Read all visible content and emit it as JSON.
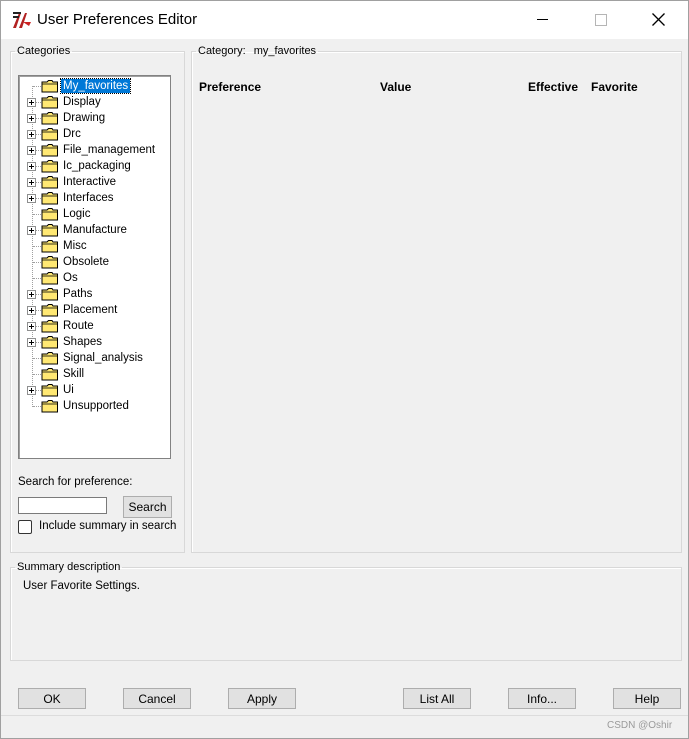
{
  "window": {
    "title": "User Preferences Editor",
    "controls": {
      "minimize": "minimize",
      "maximize": "maximize",
      "close": "close"
    }
  },
  "categories": {
    "legend": "Categories",
    "tree": [
      {
        "label": "My_favorites",
        "expandable": false,
        "selected": true
      },
      {
        "label": "Display",
        "expandable": true
      },
      {
        "label": "Drawing",
        "expandable": true
      },
      {
        "label": "Drc",
        "expandable": true
      },
      {
        "label": "File_management",
        "expandable": true
      },
      {
        "label": "Ic_packaging",
        "expandable": true
      },
      {
        "label": "Interactive",
        "expandable": true
      },
      {
        "label": "Interfaces",
        "expandable": true
      },
      {
        "label": "Logic",
        "expandable": false
      },
      {
        "label": "Manufacture",
        "expandable": true
      },
      {
        "label": "Misc",
        "expandable": false
      },
      {
        "label": "Obsolete",
        "expandable": false
      },
      {
        "label": "Os",
        "expandable": false
      },
      {
        "label": "Paths",
        "expandable": true
      },
      {
        "label": "Placement",
        "expandable": true
      },
      {
        "label": "Route",
        "expandable": true
      },
      {
        "label": "Shapes",
        "expandable": true
      },
      {
        "label": "Signal_analysis",
        "expandable": false
      },
      {
        "label": "Skill",
        "expandable": false
      },
      {
        "label": "Ui",
        "expandable": true
      },
      {
        "label": "Unsupported",
        "expandable": false
      }
    ],
    "search_label": "Search for preference:",
    "search_value": "",
    "search_button": "Search",
    "include_summary_label": "Include summary in search",
    "include_summary_checked": false
  },
  "category_panel": {
    "label": "Category:",
    "value": "my_favorites",
    "columns": [
      "Preference",
      "Value",
      "Effective",
      "Favorite"
    ]
  },
  "summary": {
    "legend": "Summary description",
    "text": "User Favorite Settings."
  },
  "buttons": {
    "ok": "OK",
    "cancel": "Cancel",
    "apply": "Apply",
    "list_all": "List All",
    "info": "Info...",
    "help": "Help"
  },
  "watermark": "CSDN @Oshir",
  "colors": {
    "selection": "#0078d7",
    "folder": "#ffe873",
    "dialog_bg": "#f0f0f0"
  }
}
